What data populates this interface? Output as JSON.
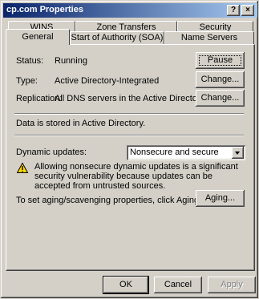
{
  "window": {
    "title": "cp.com Properties",
    "help_glyph": "?",
    "close_glyph": "×"
  },
  "tabs_row1": [
    "WINS",
    "Zone Transfers",
    "Security"
  ],
  "tabs_row2": [
    "General",
    "Start of Authority (SOA)",
    "Name Servers"
  ],
  "general": {
    "status_label": "Status:",
    "status_value": "Running",
    "pause_button": "Pause",
    "type_label": "Type:",
    "type_value": "Active Directory-Integrated",
    "type_change_button": "Change...",
    "replication_label": "Replication:",
    "replication_value": "All DNS servers in the Active Directory domain",
    "replication_change_button": "Change...",
    "storage_text": "Data is stored in Active Directory.",
    "dynamic_label": "Dynamic updates:",
    "dynamic_value": "Nonsecure and secure",
    "warning_text": "Allowing nonsecure dynamic updates is a significant security vulnerability because updates can be accepted from untrusted sources.",
    "aging_text": "To set aging/scavenging properties, click Aging.",
    "aging_button": "Aging..."
  },
  "footer": {
    "ok": "OK",
    "cancel": "Cancel",
    "apply": "Apply"
  },
  "colors": {
    "titlebar_start": "#0a246a",
    "titlebar_end": "#a6caf0",
    "face": "#d4d0c8",
    "warning": "#ffd700"
  },
  "icons": {
    "warning": "warning-triangle-icon"
  }
}
